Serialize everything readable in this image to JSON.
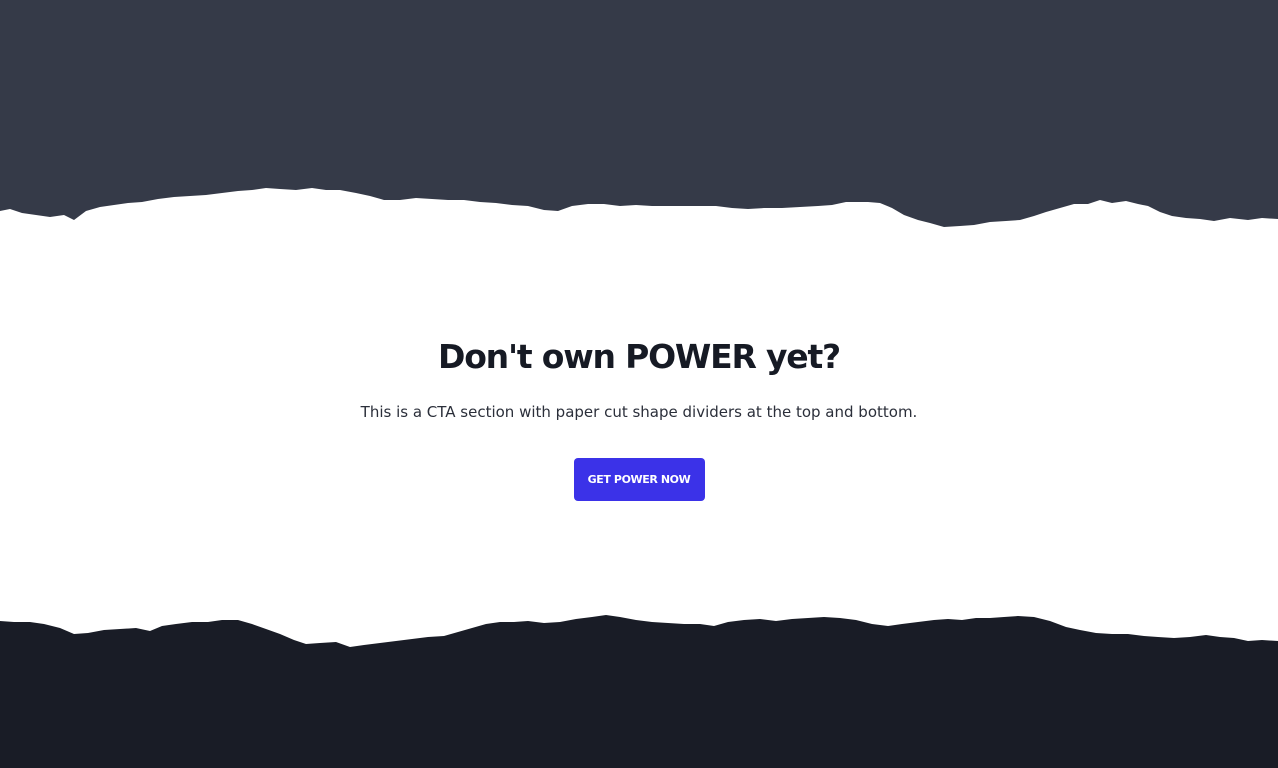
{
  "theme": {
    "top_band_color": "#353a48",
    "bottom_band_color": "#191c26",
    "background_color": "#ffffff",
    "accent_color": "#3b32e8",
    "title_color": "#161a24"
  },
  "cta": {
    "title": "Don't own POWER yet?",
    "description": "This is a CTA section with paper cut shape dividers at the top and bottom.",
    "button_label": "GET POWER NOW"
  }
}
